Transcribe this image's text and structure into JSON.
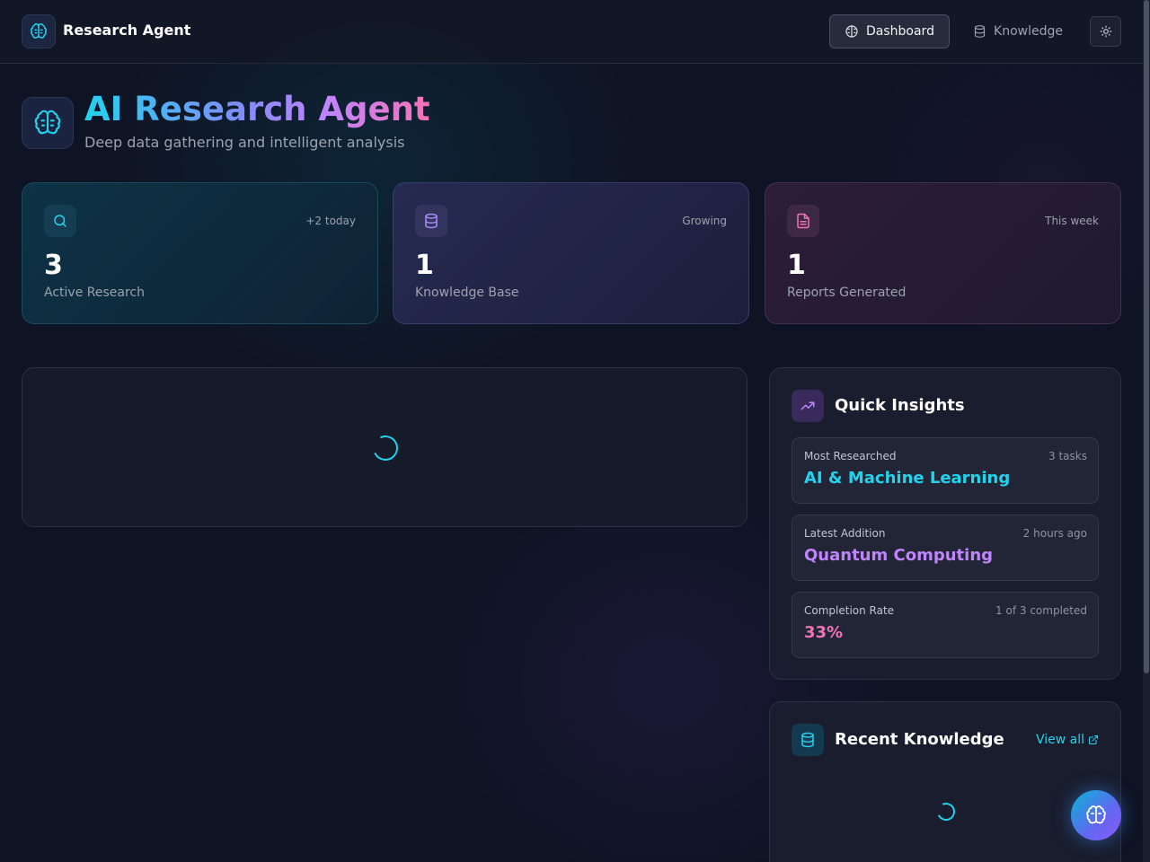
{
  "nav": {
    "brand": "Research Agent",
    "links": [
      {
        "label": "Dashboard",
        "active": true,
        "icon": "brain-icon"
      },
      {
        "label": "Knowledge",
        "active": false,
        "icon": "database-icon"
      }
    ],
    "theme_icon": "sun-icon"
  },
  "header": {
    "title": "AI Research Agent",
    "subtitle": "Deep data gathering and intelligent analysis",
    "icon": "brain-icon"
  },
  "stats": [
    {
      "icon": "search-icon",
      "badge": "+2 today",
      "value": "3",
      "label": "Active Research",
      "accent": "#22d3ee"
    },
    {
      "icon": "database-icon",
      "badge": "Growing",
      "value": "1",
      "label": "Knowledge Base",
      "accent": "#a78bfa"
    },
    {
      "icon": "file-text-icon",
      "badge": "This week",
      "value": "1",
      "label": "Reports Generated",
      "accent": "#f472b6"
    }
  ],
  "insights": {
    "title": "Quick Insights",
    "icon": "trending-up-icon",
    "items": [
      {
        "label": "Most Researched",
        "meta": "3 tasks",
        "value": "AI & Machine Learning",
        "color": "#22d3ee"
      },
      {
        "label": "Latest Addition",
        "meta": "2 hours ago",
        "value": "Quantum Computing",
        "color": "#c084fc"
      },
      {
        "label": "Completion Rate",
        "meta": "1 of 3 completed",
        "value": "33%",
        "color": "#f472b6"
      }
    ]
  },
  "knowledge": {
    "title": "Recent Knowledge",
    "view_all": "View all",
    "icon": "database-icon"
  },
  "colors": {
    "background": "#0f1424",
    "accent_cyan": "#22d3ee",
    "accent_purple": "#c084fc",
    "accent_pink": "#f472b6"
  }
}
